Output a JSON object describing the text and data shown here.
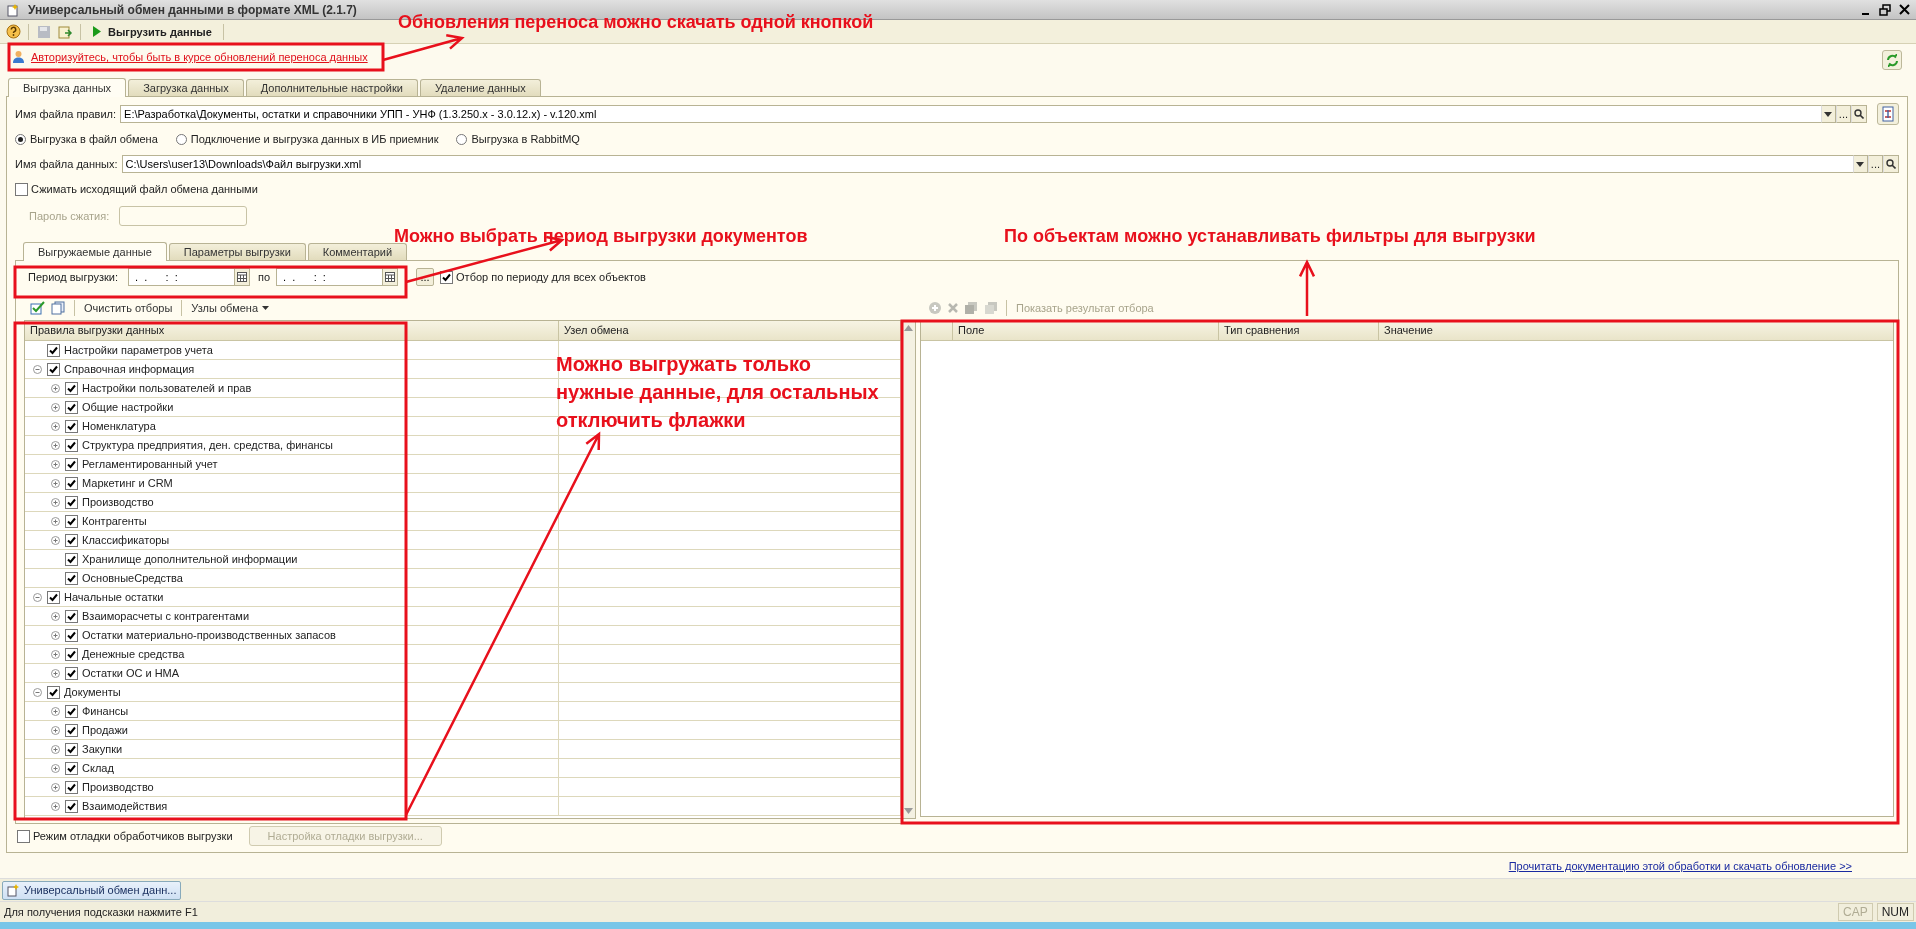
{
  "window": {
    "title": "Универсальный обмен данными в формате XML (2.1.7)"
  },
  "toolbar": {
    "export_button": "Выгрузить данные"
  },
  "auth_link": "Авторизуйтесь, чтобы быть в курсе обновлений переноса данных",
  "tabs": [
    {
      "label": "Выгрузка данных",
      "selected": true
    },
    {
      "label": "Загрузка данных",
      "selected": false
    },
    {
      "label": "Дополнительные настройки",
      "selected": false
    },
    {
      "label": "Удаление данных",
      "selected": false
    }
  ],
  "rules_file": {
    "label": "Имя файла правил:",
    "value": "E:\\Разработка\\Документы, остатки и справочники УПП - УНФ (1.3.250.x - 3.0.12.x) - v.120.xml",
    "choice_button": "..."
  },
  "export_modes": [
    {
      "label": "Выгрузка в файл обмена",
      "selected": true
    },
    {
      "label": "Подключение и выгрузка данных в ИБ приемник",
      "selected": false
    },
    {
      "label": "Выгрузка в RabbitMQ",
      "selected": false
    }
  ],
  "data_file": {
    "label": "Имя файла данных:",
    "value": "C:\\Users\\user13\\Downloads\\Файл выгрузки.xml",
    "choice_button": "..."
  },
  "compress": {
    "label": "Сжимать исходящий файл обмена данными",
    "checked": false
  },
  "password": {
    "label": "Пароль сжатия:",
    "disabled": true
  },
  "inner_tabs": [
    {
      "label": "Выгружаемые данные",
      "selected": true
    },
    {
      "label": "Параметры выгрузки",
      "selected": false
    },
    {
      "label": "Комментарий",
      "selected": false
    }
  ],
  "period": {
    "label": "Период выгрузки:",
    "from": " .  .      :  :",
    "to_label": "по",
    "to": " .  .      :  :",
    "select_button": "...",
    "filter_all": {
      "label": "Отбор по периоду для всех объектов",
      "checked": true
    }
  },
  "tree_toolbar": {
    "clear_filters": "Очистить отборы",
    "nodes_menu": "Узлы обмена"
  },
  "tree": {
    "columns": [
      "Правила выгрузки данных",
      "Узел обмена"
    ],
    "items": [
      {
        "label": "Настройки параметров учета",
        "checked": true
      },
      {
        "label": "Справочная информация",
        "checked": true,
        "expanded": true,
        "children": [
          {
            "label": "Настройки пользователей и прав",
            "checked": true,
            "expanded": false
          },
          {
            "label": "Общие настройки",
            "checked": true,
            "expanded": false
          },
          {
            "label": "Номенклатура",
            "checked": true,
            "expanded": false
          },
          {
            "label": "Структура предприятия, ден. средства, финансы",
            "checked": true,
            "expanded": false
          },
          {
            "label": "Регламентированный учет",
            "checked": true,
            "expanded": false
          },
          {
            "label": "Маркетинг и CRM",
            "checked": true,
            "expanded": false
          },
          {
            "label": "Производство",
            "checked": true,
            "expanded": false
          },
          {
            "label": "Контрагенты",
            "checked": true,
            "expanded": false
          },
          {
            "label": "Классификаторы",
            "checked": true,
            "expanded": false
          },
          {
            "label": "Хранилище дополнительной информации",
            "checked": true
          },
          {
            "label": "ОсновныеСредства",
            "checked": true
          }
        ]
      },
      {
        "label": "Начальные остатки",
        "checked": true,
        "expanded": true,
        "children": [
          {
            "label": "Взаиморасчеты с контрагентами",
            "checked": true,
            "expanded": false
          },
          {
            "label": "Остатки материально-производственных запасов",
            "checked": true,
            "expanded": false
          },
          {
            "label": "Денежные средства",
            "checked": true,
            "expanded": false
          },
          {
            "label": "Остатки ОС и НМА",
            "checked": true,
            "expanded": false
          }
        ]
      },
      {
        "label": "Документы",
        "checked": true,
        "expanded": true,
        "children": [
          {
            "label": "Финансы",
            "checked": true,
            "expanded": false
          },
          {
            "label": "Продажи",
            "checked": true,
            "expanded": false
          },
          {
            "label": "Закупки",
            "checked": true,
            "expanded": false
          },
          {
            "label": "Склад",
            "checked": true,
            "expanded": false
          },
          {
            "label": "Производство",
            "checked": true,
            "expanded": false
          },
          {
            "label": "Взаимодействия",
            "checked": true,
            "expanded": false
          }
        ]
      }
    ]
  },
  "filter_toolbar": {
    "show_result": "Показать результат отбора",
    "disabled": true
  },
  "filter_table": {
    "columns": [
      "Поле",
      "Тип сравнения",
      "Значение"
    ]
  },
  "debug": {
    "label": "Режим отладки обработчиков выгрузки",
    "checked": false,
    "settings_button": "Настройка отладки выгрузки...",
    "button_disabled": true
  },
  "doc_link": "Прочитать документацию этой обработки и скачать обновление >>",
  "taskbar": [
    {
      "label": "Универсальный обмен данн..."
    }
  ],
  "status_bar": {
    "hint": "Для получения подсказки нажмите F1",
    "indicators": [
      {
        "label": "CAP",
        "on": false
      },
      {
        "label": "NUM",
        "on": true
      }
    ]
  },
  "annotations": [
    {
      "text": "Обновления переноса можно скачать одной кнопкой"
    },
    {
      "text": "Можно выбрать период выгрузки документов"
    },
    {
      "text": "По объектам можно устанавливать фильтры для выгрузки"
    },
    {
      "text": "Можно выгружать только нужные данные, для остальных отключить флажки"
    }
  ]
}
